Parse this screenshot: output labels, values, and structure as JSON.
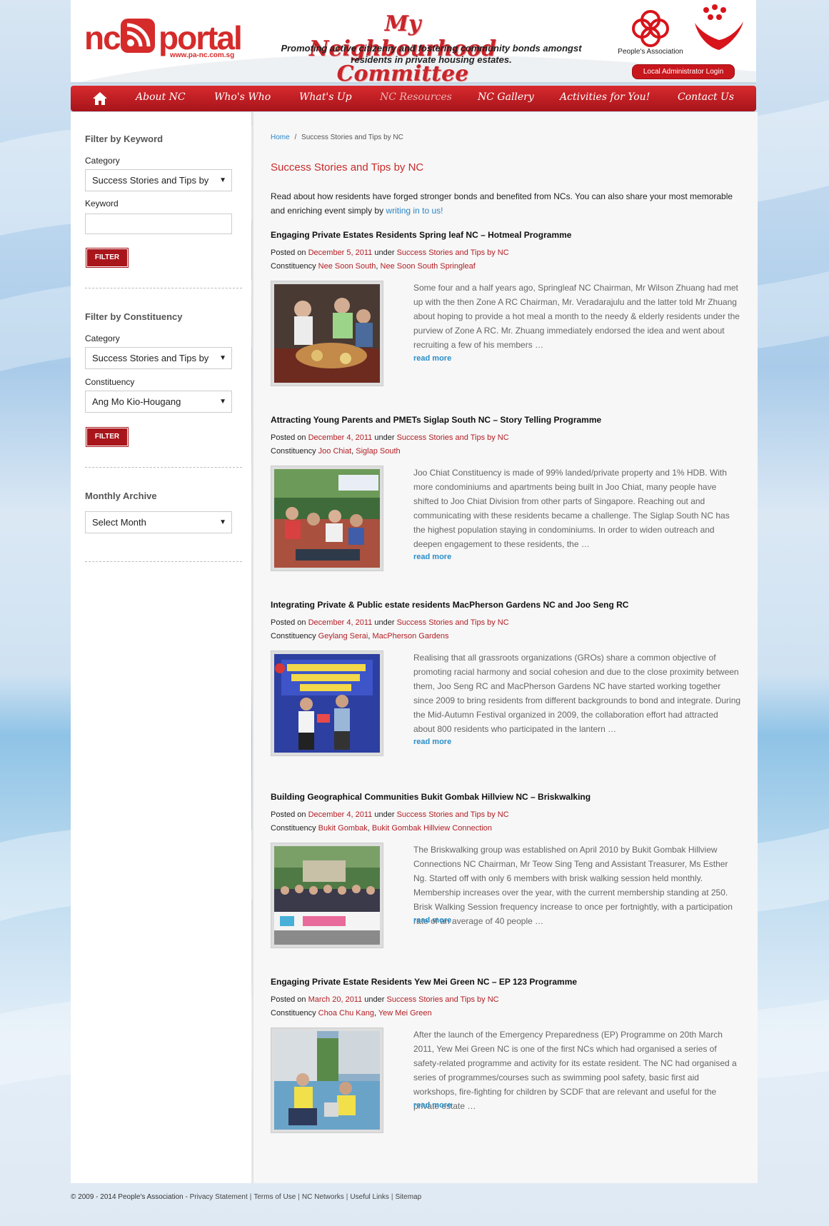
{
  "header": {
    "logo_nc": "nc",
    "logo_portal": "portal",
    "logo_url": "www.pa-nc.com.sg",
    "site_title": "My Neighbourhood Committee",
    "tagline_line1": "Promoting active citizenry and fostering community bonds amongst",
    "tagline_line2": "residents in private housing estates.",
    "pa_label": "People's Association",
    "login_label": "Local Administrator Login"
  },
  "nav": {
    "home_icon": "home-icon",
    "items": [
      {
        "label": "About NC"
      },
      {
        "label": "Who's Who"
      },
      {
        "label": "What's Up"
      },
      {
        "label": "NC Resources"
      },
      {
        "label": "NC Gallery"
      },
      {
        "label": "Activities for You!"
      },
      {
        "label": "Contact Us"
      }
    ]
  },
  "sidebar": {
    "keyword_heading": "Filter by Keyword",
    "category_label": "Category",
    "category_value": "Success Stories and Tips by",
    "keyword_label": "Keyword",
    "keyword_value": "",
    "filter_label": "FILTER",
    "constituency_heading": "Filter by Constituency",
    "category2_label": "Category",
    "category2_value": "Success Stories and Tips by",
    "constituency_label": "Constituency",
    "constituency_value": "Ang Mo Kio-Hougang",
    "filter2_label": "FILTER",
    "archive_heading": "Monthly Archive",
    "archive_value": "Select Month"
  },
  "breadcrumb": {
    "home": "Home",
    "separator": "/",
    "current": "Success Stories and Tips by NC"
  },
  "page_title": "Success Stories and Tips by NC",
  "intro": {
    "text": "Read about how residents have forged stronger bonds and benefited from NCs. You can also share your most memorable and enriching event simply by ",
    "link": "writing in to us!"
  },
  "meta_labels": {
    "posted_on": "Posted on",
    "under": "under",
    "constituency": "Constituency",
    "read_more": "read more"
  },
  "posts": [
    {
      "title": "Engaging Private Estates Residents Spring leaf NC – Hotmeal Programme",
      "date": "December 5, 2011",
      "category": "Success Stories and Tips by NC",
      "constituency1": "Nee Soon South",
      "constituency2": "Nee Soon South Springleaf",
      "excerpt": "Some four and a half years ago, Springleaf NC Chairman, Mr Wilson Zhuang had met up with the then Zone A RC Chairman, Mr. Veradarajulu and the latter told Mr Zhuang about hoping to provide a hot meal a month to the needy & elderly residents under the purview of Zone A RC. Mr. Zhuang immediately endorsed the idea and went about recruiting a few of his members …"
    },
    {
      "title": "Attracting Young Parents and PMETs Siglap South NC – Story Telling Programme",
      "date": "December 4, 2011",
      "category": "Success Stories and Tips by NC",
      "constituency1": "Joo Chiat",
      "constituency2": "Siglap South",
      "excerpt": "Joo Chiat Constituency is made of 99% landed/private property and 1% HDB. With more condominiums and apartments being built in Joo Chiat, many people have shifted to Joo Chiat Division from other parts of Singapore. Reaching out and communicating with these residents became a challenge. The Siglap South NC has the highest population staying in condominiums. In order to widen outreach and deepen engagement to these residents, the …"
    },
    {
      "title": "Integrating Private & Public estate residents MacPherson Gardens NC and Joo Seng RC",
      "date": "December 4, 2011",
      "category": "Success Stories and Tips by NC",
      "constituency1": "Geylang Serai",
      "constituency2": "MacPherson Gardens",
      "excerpt": "Realising that all grassroots organizations (GROs) share a common objective of promoting racial harmony and social cohesion and due to the close proximity between them, Joo Seng RC and MacPherson Gardens NC have started working together since 2009 to bring residents from different backgrounds to bond and integrate. During the Mid-Autumn Festival organized in 2009, the collaboration effort had attracted about 800 residents who participated in the lantern …"
    },
    {
      "title": "Building Geographical Communities Bukit Gombak Hillview NC – Briskwalking",
      "date": "December 4, 2011",
      "category": "Success Stories and Tips by NC",
      "constituency1": "Bukit Gombak",
      "constituency2": "Bukit Gombak Hillview Connection",
      "excerpt": "The Briskwalking group was established on April 2010 by Bukit Gombak Hillview Connections NC Chairman, Mr Teow Sing Teng and Assistant Treasurer, Ms Esther Ng. Started off with only 6 members with brisk walking session held monthly. Membership increases over the year, with the current membership standing at 250. Brisk Walking Session frequency increase to once per fortnightly, with a participation rate of an average of 40 people …"
    },
    {
      "title": "Engaging Private Estate Residents Yew Mei Green NC – EP 123 Programme",
      "date": "March 20, 2011",
      "category": "Success Stories and Tips by NC",
      "constituency1": "Choa Chu Kang",
      "constituency2": "Yew Mei Green",
      "excerpt": "After the launch of the Emergency Preparedness (EP) Programme on 20th March 2011, Yew Mei Green NC is one of the first NCs which had organised a series of safety-related programme and activity for its estate resident. The NC had organised a series of programmes/courses such as swimming pool safety, basic first aid workshops, fire-fighting for children by SCDF that are relevant and useful for the private estate …"
    }
  ],
  "footer": {
    "copyright": "© 2009 - 2014 People's Association -",
    "links": [
      "Privacy Statement",
      "Terms of Use",
      "NC Networks",
      "Useful Links",
      "Sitemap"
    ]
  },
  "colors": {
    "brand_red": "#c8161d",
    "link_blue": "#2a85c4",
    "title_red": "#c82b2b"
  }
}
